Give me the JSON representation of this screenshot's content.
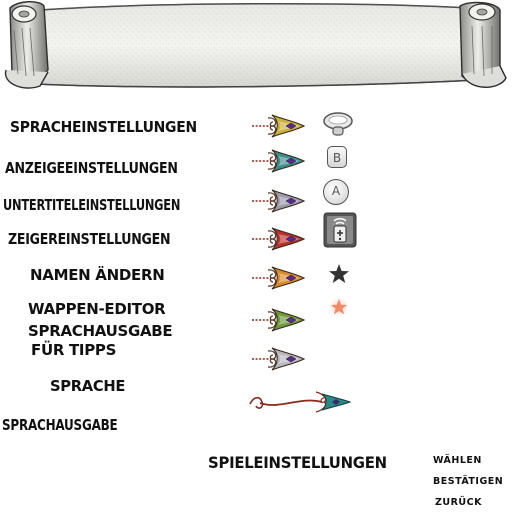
{
  "menu": {
    "items": [
      {
        "label": "SPRACHEINSTELLUNGEN",
        "arrow_color": "#c9b23a"
      },
      {
        "label": "ANZEIGEEINSTELLUNGEN",
        "arrow_color": "#3a8f8a"
      },
      {
        "label": "UNTERTITELEINSTELLUNGEN",
        "arrow_color": "#9a9aa8"
      },
      {
        "label": "ZEIGEREINSTELLUNGEN",
        "arrow_color": "#b8322a"
      },
      {
        "label": "NAMEN ÄNDERN",
        "arrow_color": "#d98a2a"
      },
      {
        "label": "WAPPEN-EDITOR",
        "arrow_color": "#6e9a3a"
      },
      {
        "label": "SPRACHAUSGABE",
        "label_line2": "FÜR TIPPS",
        "arrow_color": "#b7b7bf"
      },
      {
        "label": "SPRACHE"
      },
      {
        "label": "SPRACHAUSGABE"
      }
    ],
    "footer_title": "SPIELEINSTELLUNGEN"
  },
  "controls": {
    "select_label": "WÄHLEN",
    "confirm_label": "BESTÄTIGEN",
    "back_label": "ZURÜCK",
    "b_button": "B",
    "a_button": "A"
  },
  "icons": {
    "button_1": "control-stick-icon",
    "button_2": "b-button-icon",
    "button_3": "a-button-icon",
    "button_4": "remote-pointer-icon",
    "star_dark": "dark-star-icon",
    "star_light": "orange-star-icon",
    "long_arrow": "ornate-long-arrow-icon"
  },
  "colors": {
    "star_dark": "#333333",
    "star_light": "#f08a6a",
    "long_arrow_teal": "#2a8a8a",
    "long_arrow_red": "#8b2a1a"
  }
}
